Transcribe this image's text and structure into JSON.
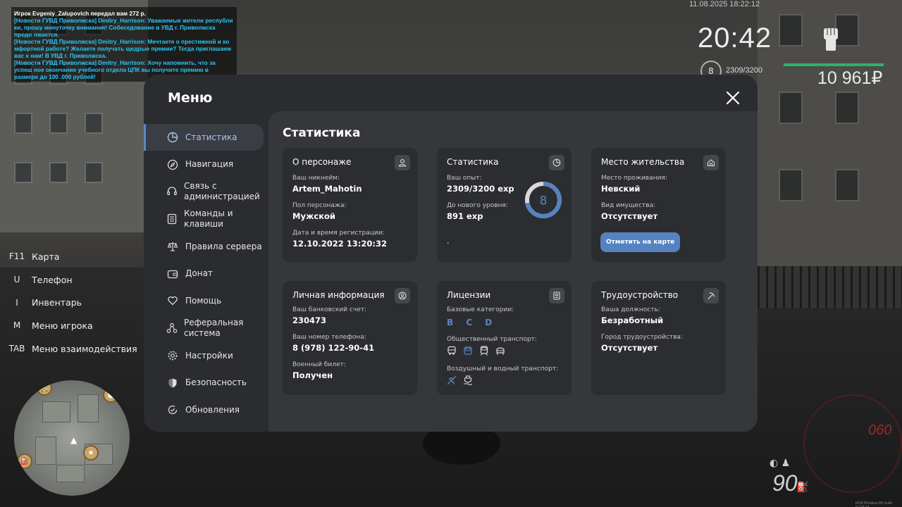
{
  "chat": {
    "lines": [
      "Игрок Evgeniy_Zalupovich передал вам 272 р.",
      "[Новости ГУВД Приволжска] Dmitry_Harrison: Уважаемые жители республи ки, прошу минуточку внимания! Собеседование в УВД г. Приволжска продо лжается.",
      "[Новости ГУВД Приволжска] Dmitry_Harrison: Мечтаете о престижной и ко мфортной работе? Желаете получать щедрые премии? Тогда приглашаем вас к нам! В УВД г. Приволжска.",
      "[Новости ГУВД Приволжска] Dmitry_Harrison: Хочу напомнить, что за успеш ное окончание учебного отдела ЦПК вы получите премию в размере до 100 .000 рублей!"
    ]
  },
  "hud": {
    "date": "11.08.2025 18:22:12",
    "time": "20:42",
    "level": "8",
    "exp": "2309/3200",
    "money": "10 961₽",
    "speed": "90",
    "speed_limit": "060",
    "health_fraction": 1.0,
    "tiny_text": "RCB Priodeva RX build 0.133.34"
  },
  "hotkeys": [
    {
      "key": "F11",
      "label": "Карта"
    },
    {
      "key": "U",
      "label": "Телефон"
    },
    {
      "key": "I",
      "label": "Инвентарь"
    },
    {
      "key": "M",
      "label": "Меню игрока"
    },
    {
      "key": "TAB",
      "label": "Меню взаимодействия"
    }
  ],
  "menu": {
    "title": "Меню",
    "sidebar": [
      {
        "label": "Статистика",
        "icon": "pie-chart-icon",
        "active": true
      },
      {
        "label": "Навигация",
        "icon": "compass-icon"
      },
      {
        "label": "Связь с администрацией",
        "icon": "headset-icon"
      },
      {
        "label": "Команды и клавиши",
        "icon": "document-list-icon"
      },
      {
        "label": "Правила сервера",
        "icon": "scales-icon"
      },
      {
        "label": "Донат",
        "icon": "wallet-icon"
      },
      {
        "label": "Помощь",
        "icon": "heart-hands-icon"
      },
      {
        "label": "Реферальная система",
        "icon": "network-icon"
      },
      {
        "label": "Настройки",
        "icon": "gear-icon"
      },
      {
        "label": "Безопасность",
        "icon": "shield-icon"
      },
      {
        "label": "Обновления",
        "icon": "refresh-check-icon"
      }
    ],
    "content_title": "Статистика",
    "cards": {
      "character": {
        "title": "О персонаже",
        "nickname_label": "Ваш никнейм:",
        "nickname": "Artem_Mahotin",
        "gender_label": "Пол персонажа:",
        "gender": "Мужской",
        "reg_label": "Дата и время регистрации:",
        "reg": "12.10.2022 13:20:32"
      },
      "stats": {
        "title": "Статистика",
        "exp_label": "Ваш опыт:",
        "exp": "2309/3200 exp",
        "next_label": "До нового уровня:",
        "next": "891 exp",
        "level": "8",
        "progress_fraction": 0.72,
        "dot": "."
      },
      "residence": {
        "title": "Место жительства",
        "place_label": "Место проживания:",
        "place": "Невский",
        "property_label": "Вид имущества:",
        "property": "Отсутствует",
        "button": "Отметить на карте"
      },
      "personal": {
        "title": "Личная информация",
        "bank_label": "Ваш банковский счет:",
        "bank": "230473",
        "phone_label": "Ваш номер телефона:",
        "phone": "8 (978) 122-90-41",
        "military_label": "Военный билет:",
        "military": "Получен"
      },
      "licenses": {
        "title": "Лицензии",
        "base_label": "Базовые категории:",
        "base": "B C D",
        "public_label": "Общественный транспорт:",
        "air_label": "Воздушный и водный транспорт:"
      },
      "employment": {
        "title": "Трудоустройство",
        "position_label": "Ваша должность:",
        "position": "Безработный",
        "city_label": "Город трудоустройства:",
        "city": "Отсутствует"
      }
    }
  },
  "colors": {
    "accent": "#5582c0",
    "card": "#2c2d30",
    "panel": "#36373a",
    "window": "#2b2c2f",
    "chat_text": "#2bc6f2",
    "health": "#2db36a"
  }
}
